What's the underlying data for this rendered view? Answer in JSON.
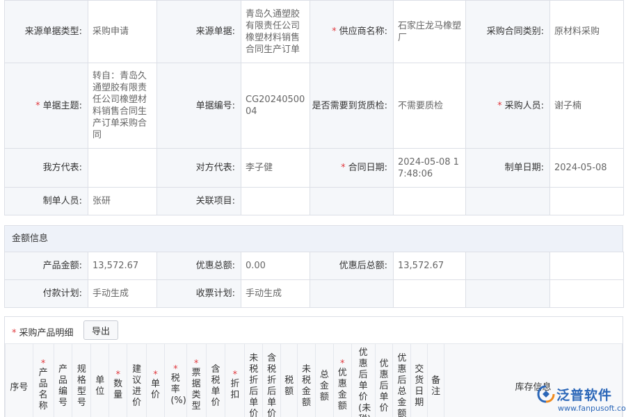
{
  "main_form": {
    "rows": [
      [
        {
          "label": "来源单据类型:",
          "required": false,
          "value": "采购申请"
        },
        {
          "label": "来源单据:",
          "required": false,
          "value": "青岛久通塑胶有限责任公司橡塑材料销售合同生产订单"
        },
        {
          "label": "供应商名称:",
          "required": true,
          "value": "石家庄龙马橡塑厂"
        },
        {
          "label": "采购合同类别:",
          "required": false,
          "value": "原材料采购"
        }
      ],
      [
        {
          "label": "单据主题:",
          "required": true,
          "value": "转自：青岛久通塑胶有限责任公司橡塑材料销售合同生产订单采购合同"
        },
        {
          "label": "单据编号:",
          "required": false,
          "value": "CG2024050004"
        },
        {
          "label": "是否需要到货质检:",
          "required": false,
          "value": "不需要质检"
        },
        {
          "label": "采购人员:",
          "required": true,
          "value": "谢子楠"
        }
      ],
      [
        {
          "label": "我方代表:",
          "required": false,
          "value": ""
        },
        {
          "label": "对方代表:",
          "required": false,
          "value": "李子健"
        },
        {
          "label": "合同日期:",
          "required": true,
          "value": "2024-05-08 17:48:06"
        },
        {
          "label": "制单日期:",
          "required": false,
          "value": "2024-05-08"
        }
      ],
      [
        {
          "label": "制单人员:",
          "required": false,
          "value": "张研"
        },
        {
          "label": "关联项目:",
          "required": false,
          "value": ""
        },
        {
          "label": "",
          "required": false,
          "value": ""
        },
        {
          "label": "",
          "required": false,
          "value": ""
        }
      ]
    ]
  },
  "amount_section": {
    "title": "金额信息",
    "rows": [
      [
        {
          "label": "产品金额:",
          "required": false,
          "value": "13,572.67"
        },
        {
          "label": "优惠总额:",
          "required": false,
          "value": "0.00"
        },
        {
          "label": "优惠后总额:",
          "required": false,
          "value": "13,572.67"
        },
        {
          "label": "",
          "required": false,
          "value": ""
        }
      ],
      [
        {
          "label": "付款计划:",
          "required": false,
          "value": "手动生成"
        },
        {
          "label": "收票计划:",
          "required": false,
          "value": "手动生成"
        },
        {
          "label": "",
          "required": false,
          "value": ""
        },
        {
          "label": "",
          "required": false,
          "value": ""
        }
      ]
    ]
  },
  "detail_section": {
    "title": "采购产品明细",
    "title_required": true,
    "export_label": "导出",
    "columns": [
      {
        "label": "序号",
        "required": false
      },
      {
        "label": "产品名称",
        "required": true
      },
      {
        "label": "产品编号",
        "required": false
      },
      {
        "label": "规格型号",
        "required": false
      },
      {
        "label": "单位",
        "required": false
      },
      {
        "label": "数量",
        "required": true
      },
      {
        "label": "建议进价",
        "required": false
      },
      {
        "label": "单价",
        "required": true
      },
      {
        "label": "税率(%)",
        "required": true
      },
      {
        "label": "票据类型",
        "required": true
      },
      {
        "label": "含税单价",
        "required": false
      },
      {
        "label": "折扣",
        "required": true
      },
      {
        "label": "未税折后单价",
        "required": false
      },
      {
        "label": "含税折后单价",
        "required": false
      },
      {
        "label": "税额",
        "required": false
      },
      {
        "label": "未税金额",
        "required": false
      },
      {
        "label": "总金额",
        "required": false
      },
      {
        "label": "优惠金额",
        "required": true
      },
      {
        "label": "优惠后单价(未税)",
        "required": false
      },
      {
        "label": "优惠后单价",
        "required": false
      },
      {
        "label": "优惠后总金额",
        "required": false
      },
      {
        "label": "交货日期",
        "required": false
      },
      {
        "label": "备注",
        "required": false
      },
      {
        "label": "库存信息",
        "required": false
      }
    ]
  },
  "watermark": {
    "brand": "泛普软件",
    "url": "www.fanpusoft.com",
    "colors": {
      "blue": "#2a66b8",
      "orange": "#f08a1c"
    }
  }
}
